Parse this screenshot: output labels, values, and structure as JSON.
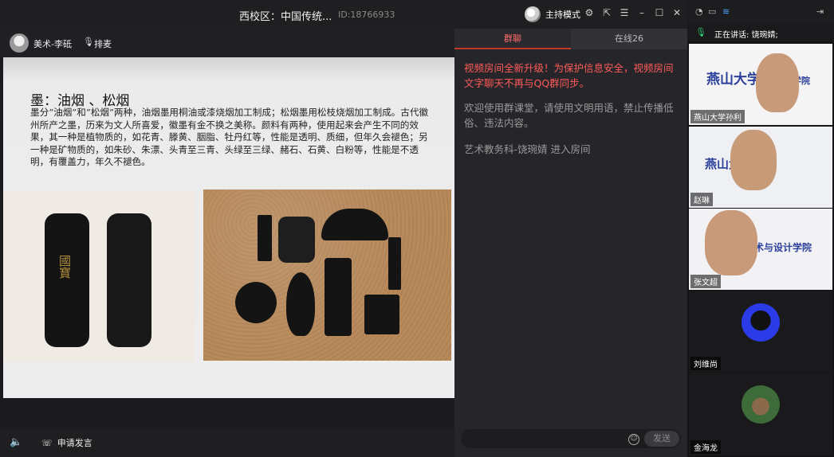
{
  "window": {
    "title": "西校区：中国传统...",
    "room_id": "ID:18766933",
    "host_mode": "主持模式",
    "icons": [
      "settings-icon",
      "share-icon",
      "menu-icon",
      "minimize-icon",
      "maximize-icon",
      "close-icon"
    ]
  },
  "presenter": {
    "name": "美术-李砥",
    "sort_label": "排麦"
  },
  "slide": {
    "heading": "墨：油烟 、松烟",
    "paragraph": "墨分“油烟”和“松烟”两种，油烟墨用桐油或漆烧烟加工制成；松烟墨用松枝烧烟加工制成。古代徽州所产之墨，历来为文人所喜爱，徽墨有金不换之美称。颜料有两种，使用起来会产生不同的效果，其一种是植物质的，如花青、滕黄、胭脂、牡丹红等，性能是透明、质细，但年久会褪色；另一种是矿物质的，如朱砂、朱漂、头青至三青、头绿至三绿、赭石、石黄、白粉等，性能是不透明，有覆盖力，年久不褪色。",
    "ink_text_left": "國寶"
  },
  "bottom": {
    "apply_speak": "申请发言"
  },
  "chat": {
    "tab_group": "群聊",
    "tab_online": "在线26",
    "notice_red": "视频房间全新升级！为保护信息安全，视频房间文字聊天不再与QQ群同步。",
    "notice_grey": "欢迎使用群课堂，请使用文明用语，禁止传播低俗、违法内容。",
    "join_msg": "艺术教务科-饶琬婧 进入房间",
    "send_label": "发送"
  },
  "sidebar": {
    "speaking": "正在讲话: 饶琬婧;",
    "participants": [
      {
        "name": "燕山大学孙利"
      },
      {
        "name": "赵琳"
      },
      {
        "name": "张文超"
      },
      {
        "name": "刘维尚"
      },
      {
        "name": "金海龙"
      }
    ],
    "wall_text": [
      "燕山大学",
      "设计学院",
      "艺术与设计学院"
    ]
  }
}
